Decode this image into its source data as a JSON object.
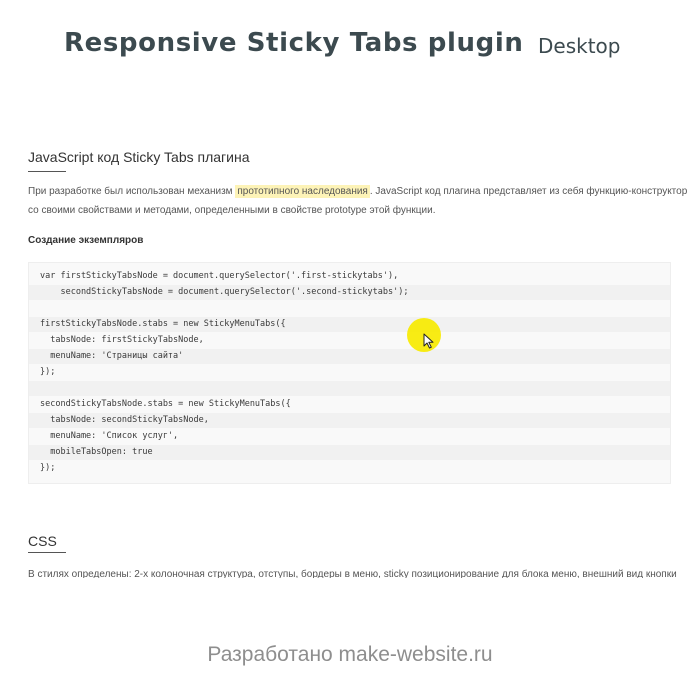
{
  "header": {
    "title": "Responsive Sticky Tabs plugin",
    "mode": "Desktop"
  },
  "section_js": {
    "heading": "JavaScript код Sticky Tabs плагина",
    "intro_before": "При разработке был использован механизм ",
    "intro_link": "прототипного наследования",
    "intro_after": ". JavaScript код плагина представляет из себя функцию-конструктор",
    "intro_line2": "со своими свойствами и методами, определенными в свойстве prototype этой функции.",
    "subheading": "Создание экземпляров"
  },
  "code_lines": [
    "var firstStickyTabsNode = document.querySelector('.first-stickytabs'),",
    "    secondStickyTabsNode = document.querySelector('.second-stickytabs');",
    "",
    "firstStickyTabsNode.stabs = new StickyMenuTabs({",
    "  tabsNode: firstStickyTabsNode,",
    "  menuName: 'Страницы сайта'",
    "});",
    "",
    "secondStickyTabsNode.stabs = new StickyMenuTabs({",
    "  tabsNode: secondStickyTabsNode,",
    "  menuName: 'Список услуг',",
    "  mobileTabsOpen: true",
    "});"
  ],
  "section_css": {
    "heading": "CSS",
    "text": "В стилях определены: 2-х колоночная структура, отступы, бордеры в меню, sticky позиционирование для блока меню, внешний вид кнопки"
  },
  "footer": {
    "credit": "Разработано make-website.ru"
  },
  "colors": {
    "highlight": "#fdf3b7",
    "cursor_highlight": "#f7ea00",
    "title_text": "#3c4a4f"
  }
}
